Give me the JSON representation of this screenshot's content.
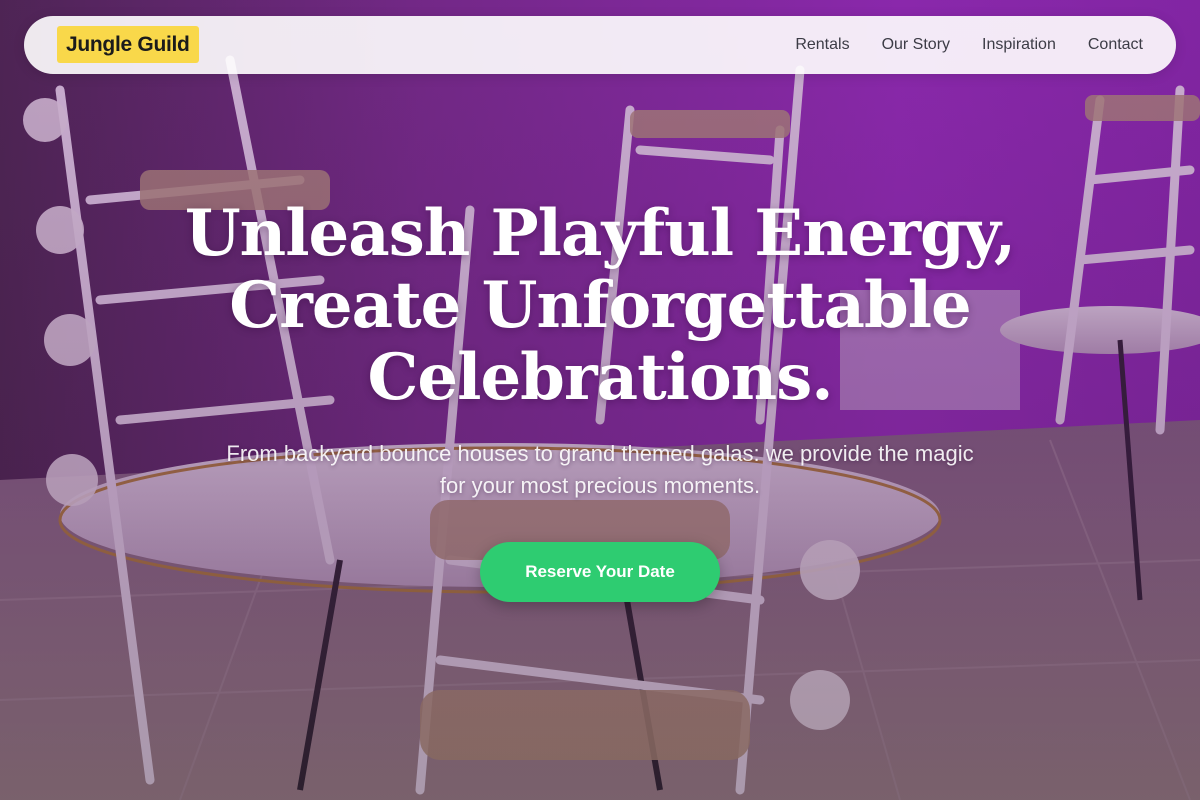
{
  "brand": {
    "name": "Jungle Guild",
    "accent": "#f9d84a"
  },
  "nav": {
    "links": [
      {
        "label": "Rentals"
      },
      {
        "label": "Our Story"
      },
      {
        "label": "Inspiration"
      },
      {
        "label": "Contact"
      }
    ]
  },
  "hero": {
    "title_line1": "Unleash Playful Energy,",
    "title_line2": "Create Unforgettable",
    "title_line3": "Celebrations.",
    "subtitle_line1": "From backyard bounce houses to grand themed galas: we provide the magic",
    "subtitle_line2": "for your most precious moments.",
    "cta_label": "Reserve Your Date",
    "cta_color": "#2ecc71",
    "background_image": "event-chairs-tables-photo"
  }
}
